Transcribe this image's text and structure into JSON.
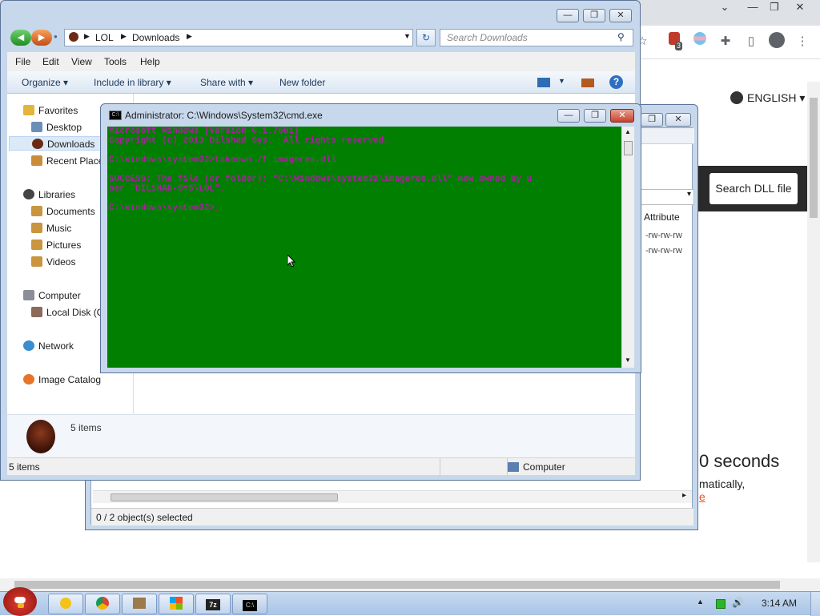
{
  "browser": {
    "language_label": "ENGLISH",
    "language_caret": "▾",
    "search_dll_label": "Search DLL file",
    "countdown_text": "0 seconds",
    "auto_text": "matically,",
    "link_fragment": "e",
    "window_controls": [
      "⌄",
      "—",
      "❐",
      "✕"
    ],
    "extension_badge": "3"
  },
  "file_manager": {
    "column_attribute": "Attribute",
    "rows": [
      "-rw-rw-rw",
      "-rw-rw-rw"
    ],
    "status_selected": "0 / 2 object(s) selected"
  },
  "explorer": {
    "breadcrumb": [
      "LOL",
      "Downloads"
    ],
    "search_placeholder": "Search Downloads",
    "menu": [
      "File",
      "Edit",
      "View",
      "Tools",
      "Help"
    ],
    "commands": {
      "organize": "Organize",
      "include_in_library": "Include in library",
      "share_with": "Share with",
      "new_folder": "New folder"
    },
    "nav": {
      "favorites": "Favorites",
      "desktop": "Desktop",
      "downloads": "Downloads",
      "recent_places": "Recent Place",
      "libraries": "Libraries",
      "documents": "Documents",
      "music": "Music",
      "pictures": "Pictures",
      "videos": "Videos",
      "computer": "Computer",
      "local_disk": "Local Disk (C",
      "network": "Network",
      "image_catalog": "Image Catalog"
    },
    "details_count": "5 items",
    "status_count": "5 items",
    "status_location": "Computer"
  },
  "console": {
    "title": "Administrator: C:\\Windows\\System32\\cmd.exe",
    "lines": [
      "Microsoft Windows [Version 6.1.7601]",
      "Copyright (c) 2013 Dilshad Sys.  All rights reserved.",
      "",
      "C:\\Windows\\system32>takeown /f imageres.dll",
      "",
      "SUCCESS: The file (or folder): \"C:\\Windows\\system32\\imageres.dll\" now owned by u",
      "ser \"DILSHAD-SYS\\LOL\".",
      "",
      "C:\\Windows\\system32>_"
    ]
  },
  "taskbar": {
    "clock": "3:14 AM",
    "apps": [
      "photos",
      "chrome",
      "installer",
      "explorer",
      "7z",
      "cmd"
    ],
    "app_7z_label": "7z",
    "app_cmd_label": "C:\\"
  },
  "colors": {
    "console_bg": "#007f00",
    "console_text": "#a8219e",
    "title_bar": "#c7d8ec",
    "taskbar": "#b9d1ee"
  }
}
